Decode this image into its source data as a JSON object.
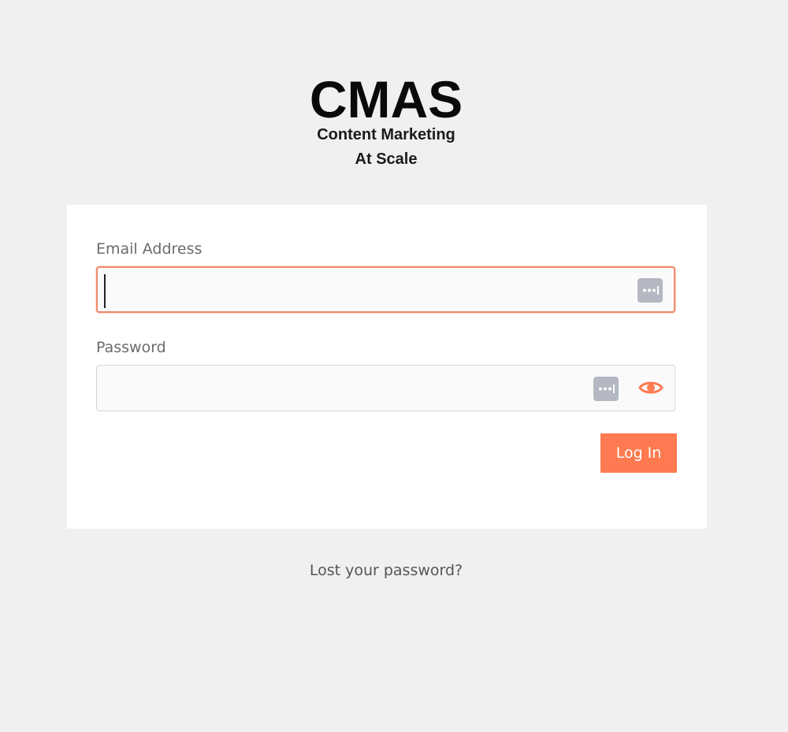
{
  "logo": {
    "title": "CMAS",
    "tagline_line1": "Content Marketing",
    "tagline_line2": "At Scale"
  },
  "form": {
    "email_label": "Email Address",
    "email_value": "",
    "password_label": "Password",
    "password_value": "",
    "login_button_label": "Log In"
  },
  "links": {
    "lost_password": "Lost your password?"
  },
  "icons": {
    "password_manager": "password-manager-icon",
    "show_password": "eye-icon"
  },
  "colors": {
    "accent": "#ff7a50",
    "focus_border": "#f08a6b",
    "background": "#f0f0f0",
    "card": "#ffffff"
  }
}
